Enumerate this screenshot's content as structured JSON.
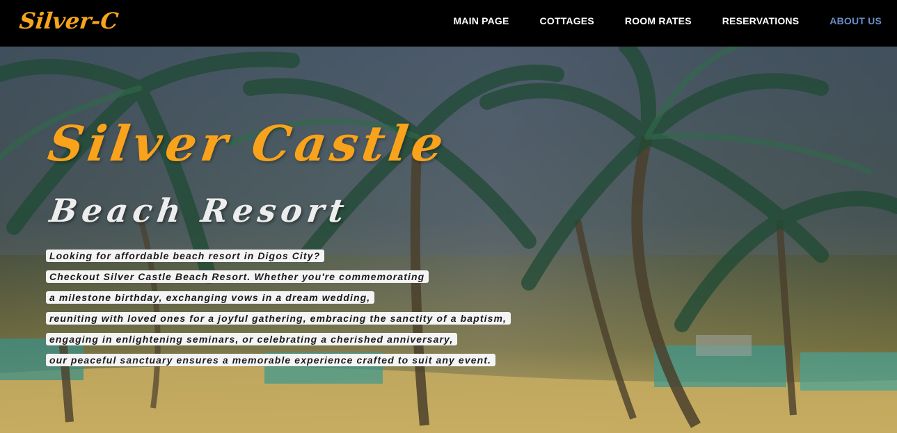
{
  "brand": {
    "logo_text": "Silver-C",
    "accent_color": "#f9a21b"
  },
  "nav": {
    "items": [
      {
        "label": "MAIN PAGE"
      },
      {
        "label": "COTTAGES"
      },
      {
        "label": "ROOM RATES"
      },
      {
        "label": "RESERVATIONS"
      },
      {
        "label": "ABOUT US",
        "active": true
      }
    ],
    "active_color": "#6a8ec9"
  },
  "hero": {
    "title": "Silver Castle",
    "subtitle": "Beach Resort",
    "description_lines": [
      "Looking for affordable beach resort in Digos City?",
      "Checkout Silver Castle Beach Resort. Whether you're commemorating",
      "a milestone birthday, exchanging vows in a dream wedding,",
      "reuniting with loved ones for a joyful gathering, embracing the sanctity of a baptism,",
      "engaging in enlightening seminars, or celebrating a cherished anniversary,",
      "our peaceful sanctuary ensures a memorable experience crafted to suit any event."
    ]
  }
}
